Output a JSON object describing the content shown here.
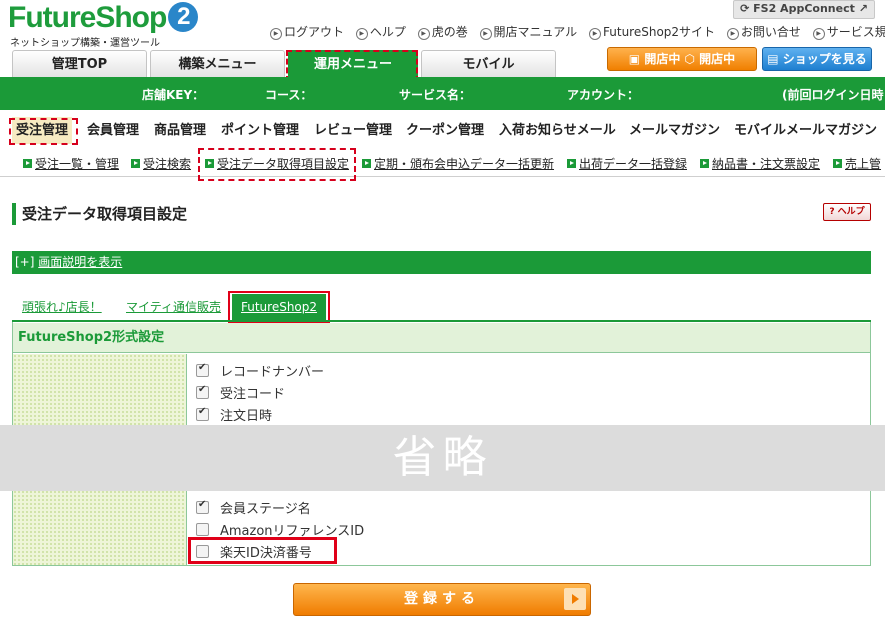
{
  "header": {
    "logo_text": "FutureShop",
    "logo_badge": "2",
    "logo_tagline": "ネットショップ構築・運営ツール",
    "app_connect": "FS2 AppConnect",
    "links": [
      "ログアウト",
      "ヘルプ",
      "虎の巻",
      "開店マニュアル",
      "FutureShop2サイト",
      "お問い合せ",
      "サービス規約"
    ],
    "shop_status_1": "開店中",
    "shop_status_2": "開店中",
    "view_shop": "ショップを見る"
  },
  "main_tabs": [
    "管理TOP",
    "構築メニュー",
    "運用メニュー",
    "モバイル"
  ],
  "info_bar": {
    "store_key": "店舗KEY：",
    "course": "コース：",
    "service": "サービス名：",
    "account": "アカウント：",
    "last_login": "(前回ログイン日時"
  },
  "submenu": [
    "受注管理",
    "会員管理",
    "商品管理",
    "ポイント管理",
    "レビュー管理",
    "クーポン管理",
    "入荷お知らせメール",
    "メールマガジン",
    "モバイルメールマガジン"
  ],
  "subsub": [
    "受注一覧・管理",
    "受注検索",
    "受注データ取得項目設定",
    "定期・頒布会申込データ一括更新",
    "出荷データ一括登録",
    "納品書・注文票設定",
    "売上管"
  ],
  "page": {
    "title": "受注データ取得項目設定",
    "help": "ヘルプ",
    "desc_prefix": "[+]",
    "desc_link": "画面説明を表示"
  },
  "format_tabs": [
    "頑張れ♪店長！",
    "マイティ通信販売",
    "FutureShop2"
  ],
  "panel": {
    "title": "FutureShop2形式設定",
    "items_top": [
      {
        "label": "レコードナンバー",
        "checked": true
      },
      {
        "label": "受注コード",
        "checked": true
      },
      {
        "label": "注文日時",
        "checked": true
      }
    ],
    "omitted": "省略",
    "items_bottom": [
      {
        "label": "会員ステージ名",
        "checked": true
      },
      {
        "label": "AmazonリファレンスID",
        "checked": false
      },
      {
        "label": "楽天ID決済番号",
        "checked": false
      }
    ]
  },
  "submit_label": "登録する"
}
